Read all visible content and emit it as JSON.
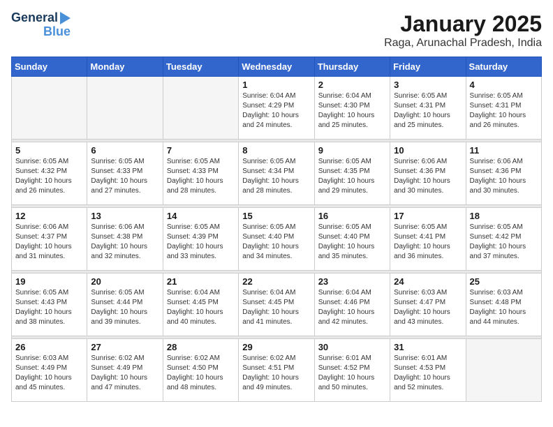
{
  "logo": {
    "line1": "General",
    "line2": "Blue"
  },
  "header": {
    "month": "January 2025",
    "location": "Raga, Arunachal Pradesh, India"
  },
  "days_of_week": [
    "Sunday",
    "Monday",
    "Tuesday",
    "Wednesday",
    "Thursday",
    "Friday",
    "Saturday"
  ],
  "weeks": [
    [
      {
        "day": "",
        "info": ""
      },
      {
        "day": "",
        "info": ""
      },
      {
        "day": "",
        "info": ""
      },
      {
        "day": "1",
        "info": "Sunrise: 6:04 AM\nSunset: 4:29 PM\nDaylight: 10 hours\nand 24 minutes."
      },
      {
        "day": "2",
        "info": "Sunrise: 6:04 AM\nSunset: 4:30 PM\nDaylight: 10 hours\nand 25 minutes."
      },
      {
        "day": "3",
        "info": "Sunrise: 6:05 AM\nSunset: 4:31 PM\nDaylight: 10 hours\nand 25 minutes."
      },
      {
        "day": "4",
        "info": "Sunrise: 6:05 AM\nSunset: 4:31 PM\nDaylight: 10 hours\nand 26 minutes."
      }
    ],
    [
      {
        "day": "5",
        "info": "Sunrise: 6:05 AM\nSunset: 4:32 PM\nDaylight: 10 hours\nand 26 minutes."
      },
      {
        "day": "6",
        "info": "Sunrise: 6:05 AM\nSunset: 4:33 PM\nDaylight: 10 hours\nand 27 minutes."
      },
      {
        "day": "7",
        "info": "Sunrise: 6:05 AM\nSunset: 4:33 PM\nDaylight: 10 hours\nand 28 minutes."
      },
      {
        "day": "8",
        "info": "Sunrise: 6:05 AM\nSunset: 4:34 PM\nDaylight: 10 hours\nand 28 minutes."
      },
      {
        "day": "9",
        "info": "Sunrise: 6:05 AM\nSunset: 4:35 PM\nDaylight: 10 hours\nand 29 minutes."
      },
      {
        "day": "10",
        "info": "Sunrise: 6:06 AM\nSunset: 4:36 PM\nDaylight: 10 hours\nand 30 minutes."
      },
      {
        "day": "11",
        "info": "Sunrise: 6:06 AM\nSunset: 4:36 PM\nDaylight: 10 hours\nand 30 minutes."
      }
    ],
    [
      {
        "day": "12",
        "info": "Sunrise: 6:06 AM\nSunset: 4:37 PM\nDaylight: 10 hours\nand 31 minutes."
      },
      {
        "day": "13",
        "info": "Sunrise: 6:06 AM\nSunset: 4:38 PM\nDaylight: 10 hours\nand 32 minutes."
      },
      {
        "day": "14",
        "info": "Sunrise: 6:05 AM\nSunset: 4:39 PM\nDaylight: 10 hours\nand 33 minutes."
      },
      {
        "day": "15",
        "info": "Sunrise: 6:05 AM\nSunset: 4:40 PM\nDaylight: 10 hours\nand 34 minutes."
      },
      {
        "day": "16",
        "info": "Sunrise: 6:05 AM\nSunset: 4:40 PM\nDaylight: 10 hours\nand 35 minutes."
      },
      {
        "day": "17",
        "info": "Sunrise: 6:05 AM\nSunset: 4:41 PM\nDaylight: 10 hours\nand 36 minutes."
      },
      {
        "day": "18",
        "info": "Sunrise: 6:05 AM\nSunset: 4:42 PM\nDaylight: 10 hours\nand 37 minutes."
      }
    ],
    [
      {
        "day": "19",
        "info": "Sunrise: 6:05 AM\nSunset: 4:43 PM\nDaylight: 10 hours\nand 38 minutes."
      },
      {
        "day": "20",
        "info": "Sunrise: 6:05 AM\nSunset: 4:44 PM\nDaylight: 10 hours\nand 39 minutes."
      },
      {
        "day": "21",
        "info": "Sunrise: 6:04 AM\nSunset: 4:45 PM\nDaylight: 10 hours\nand 40 minutes."
      },
      {
        "day": "22",
        "info": "Sunrise: 6:04 AM\nSunset: 4:45 PM\nDaylight: 10 hours\nand 41 minutes."
      },
      {
        "day": "23",
        "info": "Sunrise: 6:04 AM\nSunset: 4:46 PM\nDaylight: 10 hours\nand 42 minutes."
      },
      {
        "day": "24",
        "info": "Sunrise: 6:03 AM\nSunset: 4:47 PM\nDaylight: 10 hours\nand 43 minutes."
      },
      {
        "day": "25",
        "info": "Sunrise: 6:03 AM\nSunset: 4:48 PM\nDaylight: 10 hours\nand 44 minutes."
      }
    ],
    [
      {
        "day": "26",
        "info": "Sunrise: 6:03 AM\nSunset: 4:49 PM\nDaylight: 10 hours\nand 45 minutes."
      },
      {
        "day": "27",
        "info": "Sunrise: 6:02 AM\nSunset: 4:49 PM\nDaylight: 10 hours\nand 47 minutes."
      },
      {
        "day": "28",
        "info": "Sunrise: 6:02 AM\nSunset: 4:50 PM\nDaylight: 10 hours\nand 48 minutes."
      },
      {
        "day": "29",
        "info": "Sunrise: 6:02 AM\nSunset: 4:51 PM\nDaylight: 10 hours\nand 49 minutes."
      },
      {
        "day": "30",
        "info": "Sunrise: 6:01 AM\nSunset: 4:52 PM\nDaylight: 10 hours\nand 50 minutes."
      },
      {
        "day": "31",
        "info": "Sunrise: 6:01 AM\nSunset: 4:53 PM\nDaylight: 10 hours\nand 52 minutes."
      },
      {
        "day": "",
        "info": ""
      }
    ]
  ]
}
